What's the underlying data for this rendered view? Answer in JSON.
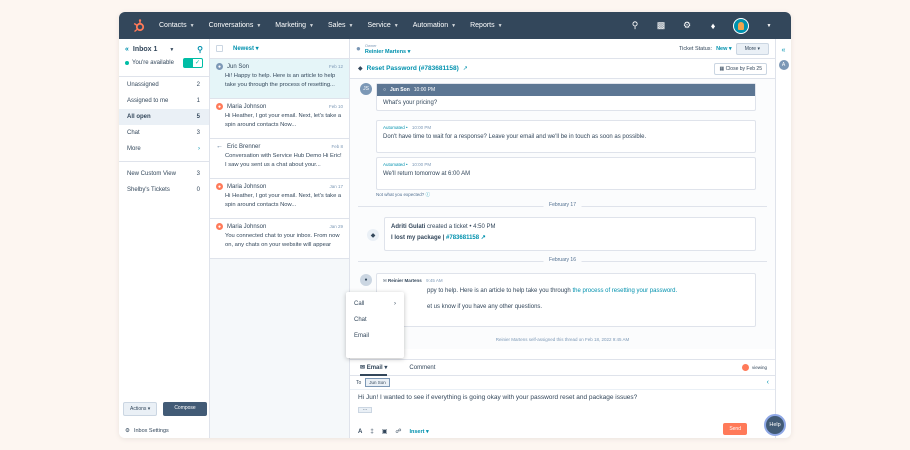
{
  "nav": {
    "items": [
      "Contacts",
      "Conversations",
      "Marketing",
      "Sales",
      "Service",
      "Automation",
      "Reports"
    ]
  },
  "sidebar": {
    "inbox_title": "Inbox 1",
    "availability": "You're available",
    "items": [
      {
        "label": "Unassigned",
        "count": "2"
      },
      {
        "label": "Assigned to me",
        "count": "1"
      },
      {
        "label": "All open",
        "count": "5"
      },
      {
        "label": "Chat",
        "count": "3"
      },
      {
        "label": "More",
        "count": ""
      },
      {
        "label": "New Custom View",
        "count": "3"
      },
      {
        "label": "Shelby's Tickets",
        "count": "0"
      }
    ],
    "actions_label": "Actions",
    "compose_label": "Compose",
    "settings_label": "Inbox Settings"
  },
  "conversations": {
    "sort_label": "Newest",
    "items": [
      {
        "name": "Jun Son",
        "date": "Feb 12",
        "text": "Hi! Happy to help. Here is an article to help take you through the process of resetting...",
        "color": "#7c98b6"
      },
      {
        "name": "Maria Johnson",
        "date": "Feb 10",
        "text": "Hi Heather, I got your email. Next, let's take a spin around contacts Now...",
        "color": "#ff7a59"
      },
      {
        "name": "Eric Brenner",
        "date": "Feb 8",
        "text": "Conversation with Service Hub Demo Hi Eric! I saw you sent us a chat about your...",
        "color": "#516f90"
      },
      {
        "name": "Maria Johnson",
        "date": "Jan 17",
        "text": "Hi Heather, I got your email. Next, let's take a spin around contacts Now...",
        "color": "#ff7a59"
      },
      {
        "name": "Maria Johnson",
        "date": "Jan 29",
        "text": "You connected chat to your inbox. From now on, any chats on your website will appear her...",
        "color": "#ff7a59"
      }
    ]
  },
  "header": {
    "owner_label": "Owner",
    "owner_name": "Reinier Martens",
    "ticket_status_label": "Ticket Status:",
    "ticket_status_value": "New",
    "more_label": "More"
  },
  "ticket": {
    "title": "Reset Password (#783681158)",
    "close_by": "Close by Feb 25"
  },
  "thread": {
    "msg1": {
      "sender": "Jun Son",
      "time": "10:00 PM",
      "text": "What's your pricing?"
    },
    "auto1": {
      "label": "Automated",
      "time": "10:00 PM",
      "text": "Don't have time to wait for a response? Leave your email and we'll be in touch as soon as possible."
    },
    "auto2": {
      "label": "Automated",
      "time": "10:00 PM",
      "text": "We'll return tomorrow at 6:00 AM"
    },
    "not_expected": "Not what you expected?",
    "date1": "February 17",
    "ticket_event": {
      "who": "Adriti Gulati",
      "action": "created a ticket",
      "time": "4:50 PM",
      "title": "I lost my package |",
      "ticket_no": "#783681158"
    },
    "date2": "February 16",
    "reply": {
      "sender": "Reinier Martens",
      "time": "9:45 AM",
      "text_pre": "ppy to help. Here is an article to help take you through",
      "link": "the process of resetting your password.",
      "text2": "et us know if you have any other questions."
    },
    "assigned_note": "Reinier Martens self-assigned this thread on Feb 18, 2022 9:45 AM"
  },
  "composer": {
    "tab_email": "Email",
    "tab_comment": "Comment",
    "viewing": "viewing",
    "to_label": "To",
    "to_chip": "Jun Son",
    "body": "Hi Jun! I wanted to see if everything is going okay with your password reset and package issues?",
    "insert_label": "Insert",
    "send_label": "Send"
  },
  "popup": {
    "items": [
      "Call",
      "Chat",
      "Email"
    ]
  },
  "rail": {
    "avatar_letter": "A"
  },
  "help_label": "Help"
}
